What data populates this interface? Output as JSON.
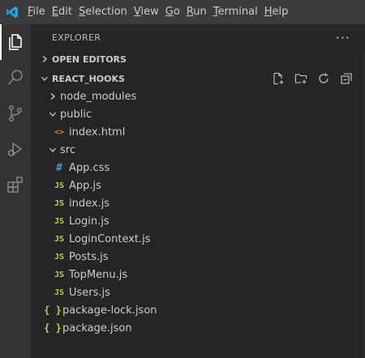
{
  "menu": [
    {
      "label": "File",
      "accel": "F",
      "rest": "ile"
    },
    {
      "label": "Edit",
      "accel": "E",
      "rest": "dit"
    },
    {
      "label": "Selection",
      "accel": "S",
      "rest": "election"
    },
    {
      "label": "View",
      "accel": "V",
      "rest": "iew"
    },
    {
      "label": "Go",
      "accel": "G",
      "rest": "o"
    },
    {
      "label": "Run",
      "accel": "R",
      "rest": "un"
    },
    {
      "label": "Terminal",
      "accel": "T",
      "rest": "erminal"
    },
    {
      "label": "Help",
      "accel": "H",
      "rest": "elp"
    }
  ],
  "explorer": {
    "title": "EXPLORER",
    "more": "···",
    "open_editors": "OPEN EDITORS",
    "project": "REACT_HOOKS"
  },
  "tree": {
    "node_modules": "node_modules",
    "public": "public",
    "index_html": "index.html",
    "src": "src",
    "app_css": "App.css",
    "app_js": "App.js",
    "index_js": "index.js",
    "login_js": "Login.js",
    "loginctx_js": "LoginContext.js",
    "posts_js": "Posts.js",
    "topmenu_js": "TopMenu.js",
    "users_js": "Users.js",
    "package_lock": "package-lock.json",
    "package": "package.json"
  },
  "icons": {
    "css_glyph": "#",
    "js_glyph": "JS",
    "json_glyph": "{ }",
    "html_glyph": "<>"
  },
  "colors": {
    "accent_logo": "#23a9f2",
    "js": "#cbcb41",
    "css": "#519aba",
    "html": "#e37933"
  }
}
